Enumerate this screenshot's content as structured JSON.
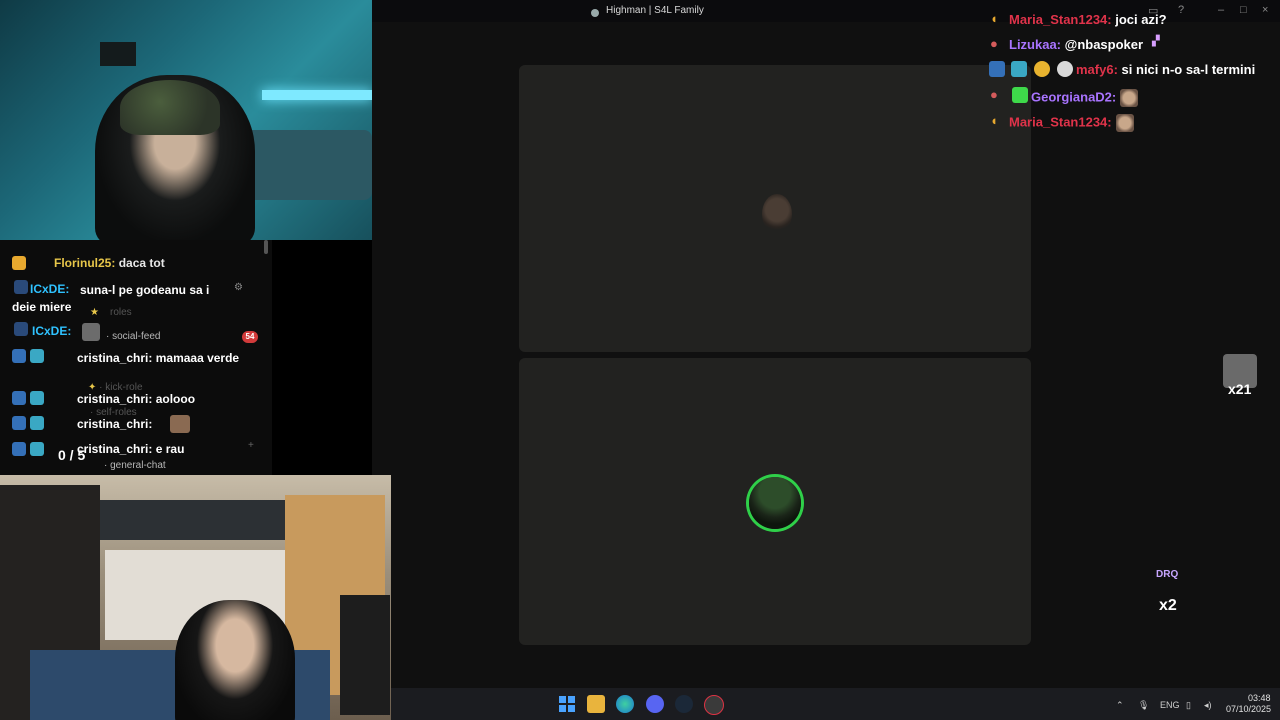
{
  "window": {
    "title": "Highman | S4L Family"
  },
  "left_chat": [
    {
      "user": "Florinul25:",
      "msg": "daca tot",
      "color": "#e8c74a"
    },
    {
      "user": "ICxDE:",
      "msg": "suna-l pe godeanu sa i deie miere",
      "color": "#2fc2ff"
    },
    {
      "user": "ICxDE:",
      "msg": "",
      "color": "#2fc2ff"
    },
    {
      "user": "cristina_chri:",
      "msg": "mamaaa verde",
      "color": "#e8e8e8"
    },
    {
      "user": "cristina_chri:",
      "msg": "aolooo",
      "color": "#e8e8e8"
    },
    {
      "user": "cristina_chri:",
      "msg": "",
      "color": "#e8e8e8"
    },
    {
      "user": "cristina_chri:",
      "msg": "e rau",
      "color": "#e8e8e8"
    }
  ],
  "discord_channels": {
    "roles": "roles",
    "social_feed": "social-feed",
    "social_feed_badge": "54",
    "kick_role": "kick-role",
    "self_roles": "self-roles",
    "general_chat": "general-chat"
  },
  "counter": "0 / 5",
  "right_chat": [
    {
      "user": "Maria_Stan1234:",
      "msg": "joci azi?",
      "color": "#e0334a"
    },
    {
      "user": "Lizukaa:",
      "msg": "@nbaspoker",
      "color": "#a974ff"
    },
    {
      "user": "mafy6:",
      "msg": "si nici n-o sa-l termini",
      "color": "#e0334a"
    },
    {
      "user": "GeorgianaD2:",
      "msg": "",
      "color": "#a974ff"
    },
    {
      "user": "Maria_Stan1234:",
      "msg": "",
      "color": "#e0334a"
    }
  ],
  "alerts": {
    "x21": "x21",
    "drq": "DRQ",
    "x2": "x2"
  },
  "taskbar": {
    "lang": "ENG",
    "time": "03:48",
    "date": "07/10/2025"
  },
  "icons": [
    "windows-start-icon",
    "file-explorer-icon",
    "edge-browser-icon",
    "discord-icon",
    "steam-icon",
    "app-icon"
  ],
  "colors": {
    "speaking_ring": "#2fd049",
    "tile_bg": "#222220"
  }
}
